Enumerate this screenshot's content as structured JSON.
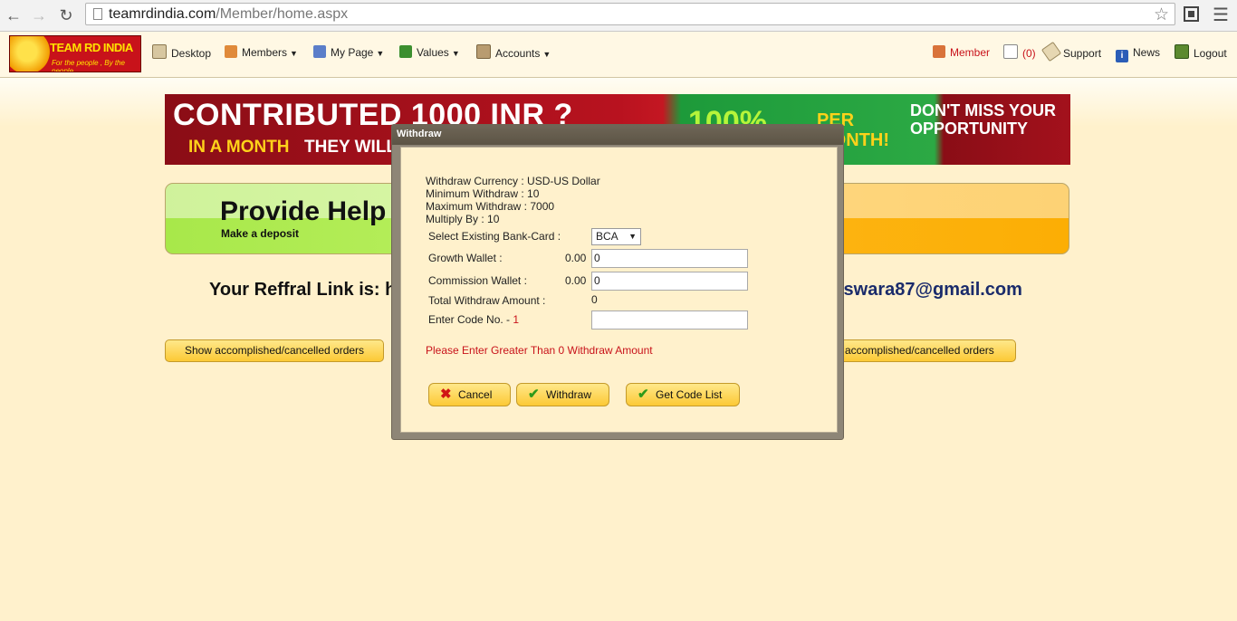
{
  "browser": {
    "url_host": "teamrdindia.com",
    "url_path": "/Member/home.aspx"
  },
  "logo": {
    "title": "TEAM RD INDIA",
    "tagline": "For the people , By the people"
  },
  "nav": {
    "desktop": "Desktop",
    "members": "Members",
    "mypage": "My Page",
    "values": "Values",
    "accounts": "Accounts",
    "member": "Member",
    "mail_count": "(0)",
    "support": "Support",
    "news": "News",
    "logout": "Logout"
  },
  "banner": {
    "line1": "CONTRIBUTED 1000 INR ?",
    "line2a": "IN A MONTH",
    "line2b": "THEY WILL",
    "pct": "100%",
    "per": "PER",
    "month": "MONTH!",
    "cta": "DON'T MISS YOUR OPPORTUNITY"
  },
  "help": {
    "title": "Provide Help",
    "subtitle": "Make a deposit"
  },
  "referral": {
    "label": "Your Reffral Link is: h",
    "email_tail": "iswara87@gmail.com"
  },
  "orders": {
    "left_label": "Show accomplished/cancelled orders",
    "right_label": "accomplished/cancelled orders"
  },
  "modal": {
    "title": "Withdraw",
    "currency": "Withdraw Currency : USD-US Dollar",
    "minimum": "Minimum Withdraw : 10",
    "maximum": "Maximum Withdraw : 7000",
    "multiply": "Multiply By : 10",
    "bank_label": "Select Existing Bank-Card :",
    "bank_value": "BCA",
    "growth_label": "Growth Wallet :",
    "growth_balance": "0.00",
    "growth_value": "0",
    "commission_label": "Commission Wallet :",
    "commission_balance": "0.00",
    "commission_value": "0",
    "total_label": "Total Withdraw Amount :",
    "total_value": "0",
    "code_label": "Enter Code No. -",
    "code_number": "1",
    "code_value": "",
    "error": "Please Enter Greater Than 0 Withdraw Amount",
    "cancel": "Cancel",
    "withdraw": "Withdraw",
    "code_list": "Get Code List"
  },
  "colors": {
    "accent_red": "#c8121a",
    "button_yellow": "#fcc935",
    "page_bg": "#fff1cc"
  }
}
